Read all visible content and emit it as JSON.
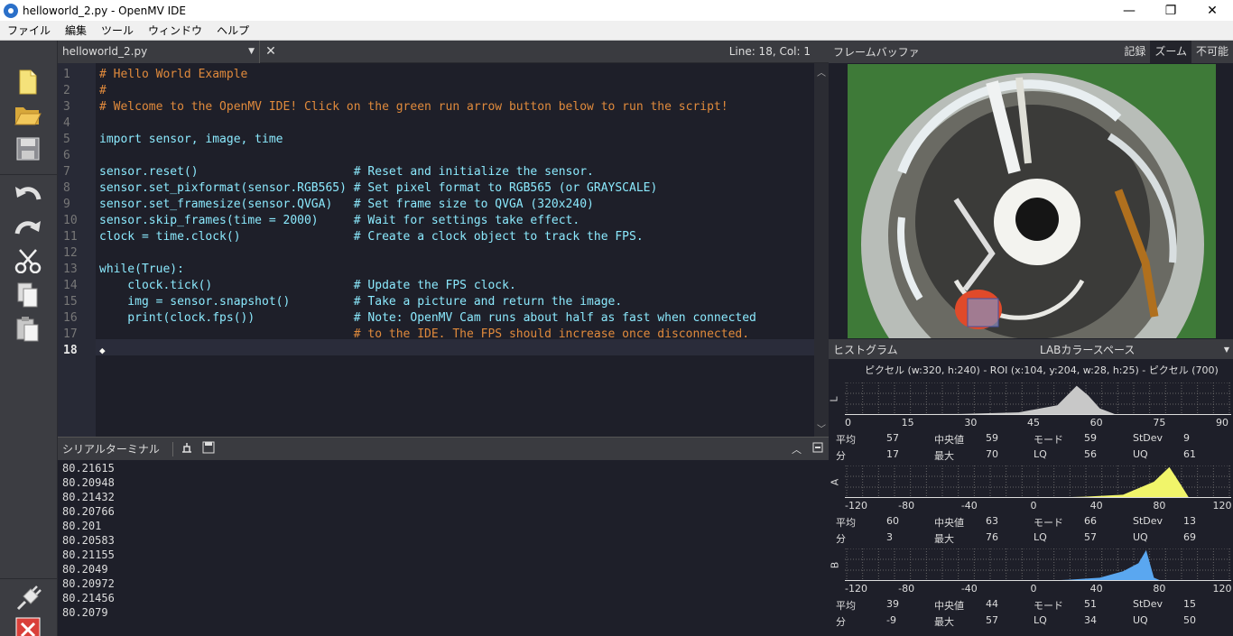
{
  "window": {
    "title": "helloworld_2.py - OpenMV IDE",
    "minimize": "—",
    "maximize": "❐",
    "close": "✕"
  },
  "menu": [
    "ファイル",
    "編集",
    "ツール",
    "ウィンドウ",
    "ヘルプ"
  ],
  "editor": {
    "filename": "helloworld_2.py",
    "linecol": "Line: 18, Col: 1",
    "lines": [
      "# Hello World Example",
      "#",
      "# Welcome to the OpenMV IDE! Click on the green run arrow button below to run the script!",
      "",
      "import sensor, image, time",
      "",
      "sensor.reset()                      # Reset and initialize the sensor.",
      "sensor.set_pixformat(sensor.RGB565) # Set pixel format to RGB565 (or GRAYSCALE)",
      "sensor.set_framesize(sensor.QVGA)   # Set frame size to QVGA (320x240)",
      "sensor.skip_frames(time = 2000)     # Wait for settings take effect.",
      "clock = time.clock()                # Create a clock object to track the FPS.",
      "",
      "while(True):",
      "    clock.tick()                    # Update the FPS clock.",
      "    img = sensor.snapshot()         # Take a picture and return the image.",
      "    print(clock.fps())              # Note: OpenMV Cam runs about half as fast when connected",
      "                                    # to the IDE. The FPS should increase once disconnected.",
      "◆"
    ]
  },
  "serial": {
    "title": "シリアルターミナル",
    "lines": [
      "80.21615",
      "80.20948",
      "80.21432",
      "80.20766",
      "80.201",
      "80.20583",
      "80.21155",
      "80.2049",
      "80.20972",
      "80.21456",
      "80.2079"
    ]
  },
  "framebuffer": {
    "label": "フレームバッファ",
    "record": "記録",
    "zoom": "ズーム",
    "disable": "不可能"
  },
  "histogram": {
    "label": "ヒストグラム",
    "colorspace": "LABカラースペース",
    "info": "ピクセル (w:320, h:240) -  ROI (x:104, y:204, w:28, h:25) - ピクセル (700)",
    "channels": [
      {
        "name": "L",
        "ticks": [
          "0",
          "15",
          "30",
          "45",
          "60",
          "75",
          "90"
        ],
        "stats": {
          "mean_label": "平均",
          "mean": "57",
          "median_label": "中央値",
          "median": "59",
          "mode_label": "モード",
          "mode": "59",
          "stdev_label": "StDev",
          "stdev": "9",
          "min_label": "分",
          "min": "17",
          "max_label": "最大",
          "max": "70",
          "lq_label": "LQ",
          "lq": "56",
          "uq_label": "UQ",
          "uq": "61"
        }
      },
      {
        "name": "A",
        "ticks": [
          "-120",
          "-80",
          "-40",
          "0",
          "40",
          "80",
          "120"
        ],
        "stats": {
          "mean_label": "平均",
          "mean": "60",
          "median_label": "中央値",
          "median": "63",
          "mode_label": "モード",
          "mode": "66",
          "stdev_label": "StDev",
          "stdev": "13",
          "min_label": "分",
          "min": "3",
          "max_label": "最大",
          "max": "76",
          "lq_label": "LQ",
          "lq": "57",
          "uq_label": "UQ",
          "uq": "69"
        }
      },
      {
        "name": "B",
        "ticks": [
          "-120",
          "-80",
          "-40",
          "0",
          "40",
          "80",
          "120"
        ],
        "stats": {
          "mean_label": "平均",
          "mean": "39",
          "median_label": "中央値",
          "median": "44",
          "mode_label": "モード",
          "mode": "51",
          "stdev_label": "StDev",
          "stdev": "15",
          "min_label": "分",
          "min": "-9",
          "max_label": "最大",
          "max": "57",
          "lq_label": "LQ",
          "lq": "34",
          "uq_label": "UQ",
          "uq": "50"
        }
      }
    ]
  }
}
